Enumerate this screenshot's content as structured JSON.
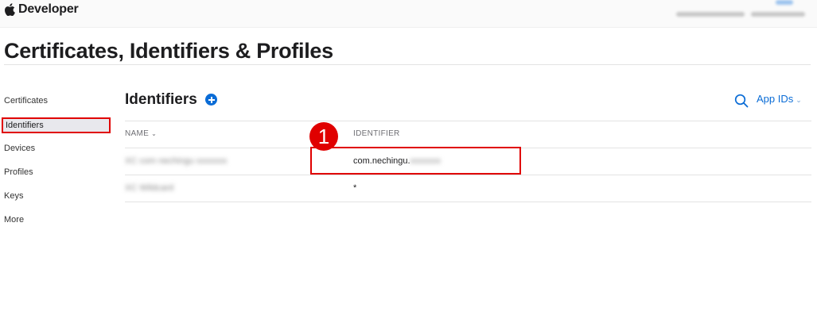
{
  "header": {
    "brand": "Developer",
    "account_link": "Account",
    "account_name": "user name",
    "team_id": "team id"
  },
  "page": {
    "title": "Certificates, Identifiers & Profiles"
  },
  "sidebar": {
    "items": [
      {
        "label": "Certificates"
      },
      {
        "label": "Identifiers",
        "active": true
      },
      {
        "label": "Devices"
      },
      {
        "label": "Profiles"
      },
      {
        "label": "Keys"
      },
      {
        "label": "More"
      }
    ]
  },
  "main": {
    "section_title": "Identifiers",
    "filter_label": "App IDs",
    "columns": [
      {
        "label": "NAME"
      },
      {
        "label": "IDENTIFIER"
      }
    ],
    "rows": [
      {
        "name": "XC com nechingu xxxxxxx",
        "identifier_prefix": "com.nechingu.",
        "identifier_hidden": "xxxxxxx"
      },
      {
        "name": "XC Wildcard",
        "identifier_prefix": "*",
        "identifier_hidden": ""
      }
    ]
  },
  "annotation": {
    "step": "1"
  },
  "colors": {
    "accent": "#0a6cd6",
    "highlight": "#e00000"
  }
}
